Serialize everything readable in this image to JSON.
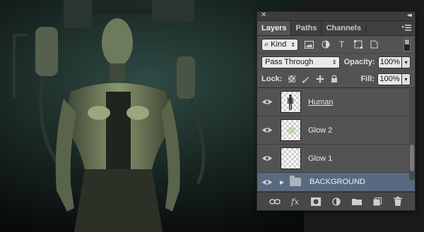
{
  "panel": {
    "close_glyph": "✕",
    "collapse_glyph": "◂◂",
    "tabs": [
      {
        "label": "Layers",
        "active": true
      },
      {
        "label": "Paths",
        "active": false
      },
      {
        "label": "Channels",
        "active": false
      }
    ],
    "panel_menu_icon": "hamburger-icon",
    "filter": {
      "kind_label": "Kind",
      "icons": [
        "image-filter-icon",
        "adjustment-filter-icon",
        "type-filter-icon",
        "shape-filter-icon",
        "smart-object-filter-icon"
      ]
    },
    "blend_mode": "Pass Through",
    "opacity_label": "Opacity:",
    "opacity_value": "100%",
    "lock_label": "Lock:",
    "lock_icons": [
      "lock-transparent-icon",
      "lock-image-icon",
      "lock-position-icon",
      "lock-all-icon"
    ],
    "fill_label": "Fill:",
    "fill_value": "100%",
    "layers": [
      {
        "name": "Human",
        "visible": true,
        "underlined": true
      },
      {
        "name": "Glow 2",
        "visible": true,
        "underlined": false
      },
      {
        "name": "Glow 1",
        "visible": true,
        "underlined": false
      }
    ],
    "group": {
      "name": "BACKGROUND",
      "visible": true,
      "expanded": false,
      "selected_color": "#596a80"
    },
    "bottom_icons": [
      "link-layers-icon",
      "fx-icon",
      "add-mask-icon",
      "adjustment-layer-icon",
      "new-group-icon",
      "new-layer-icon",
      "trash-icon"
    ]
  },
  "colors": {
    "panel_bg": "#535353",
    "tab_bar": "#3f3f3f",
    "selected_layer": "#596a80"
  }
}
